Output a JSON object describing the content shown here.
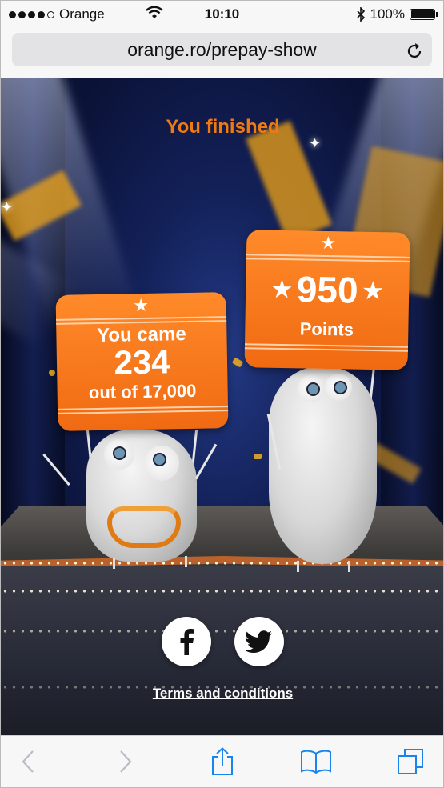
{
  "status_bar": {
    "carrier": "Orange",
    "time": "10:10",
    "battery": "100%",
    "battery_level": 1.0,
    "signal_bars": 4
  },
  "browser": {
    "url": "orange.ro/prepay-show"
  },
  "game": {
    "title": "You finished",
    "rank_sign": {
      "line1": "You came",
      "rank": "234",
      "line3": "out of 17,000"
    },
    "points_sign": {
      "points": "950",
      "label": "Points"
    },
    "accent_color": "#f07a12"
  },
  "footer": {
    "terms_link": "Terms and conditions"
  },
  "icons": {
    "facebook": "facebook-icon",
    "twitter": "twitter-icon",
    "back": "back-arrow-icon",
    "forward": "forward-arrow-icon",
    "share": "share-icon",
    "bookmarks": "bookmarks-icon",
    "tabs": "tabs-icon",
    "reload": "reload-icon"
  }
}
